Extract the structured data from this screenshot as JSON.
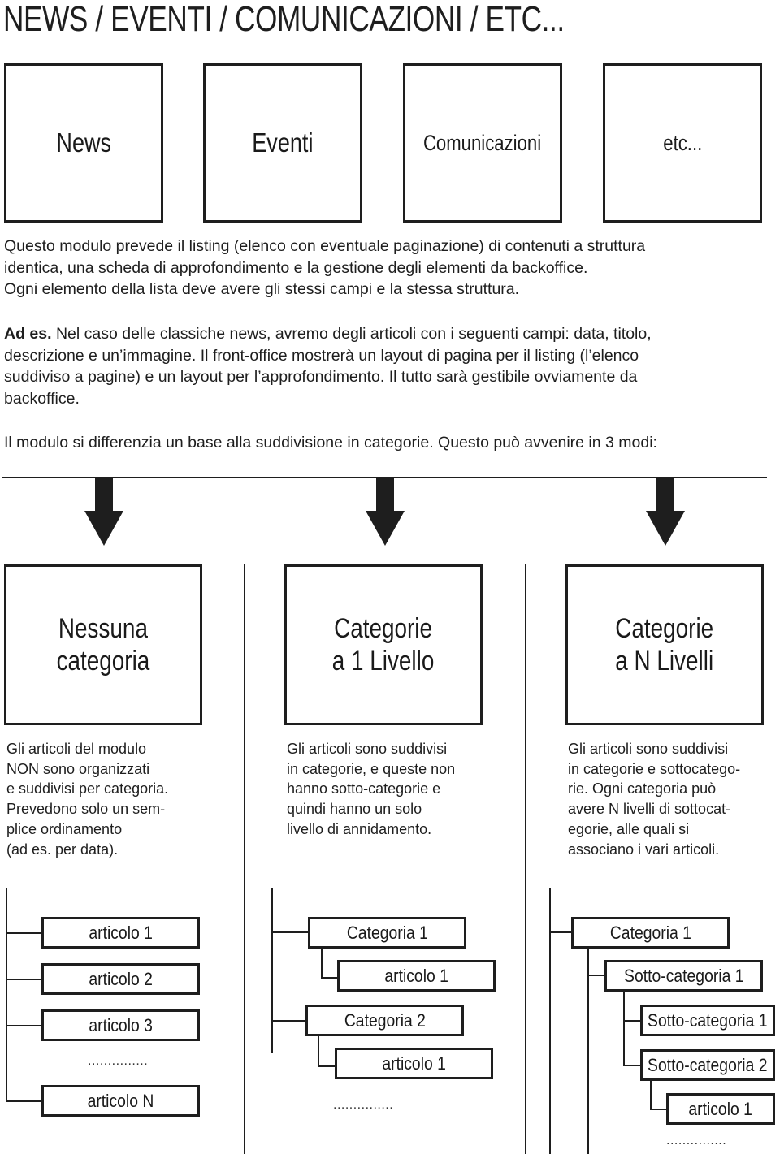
{
  "header": {
    "title": "NEWS / EVENTI / COMUNICAZIONI / ETC..."
  },
  "modules": [
    {
      "label": "News"
    },
    {
      "label": "Eventi"
    },
    {
      "label": "Comunicazioni"
    },
    {
      "label": "etc..."
    }
  ],
  "intro": {
    "p1": [
      "Questo modulo prevede il listing (elenco con eventuale paginazione) di contenuti a struttura",
      "identica, una scheda di approfondimento e la gestione degli elementi da backoffice.",
      "Ogni elemento della lista deve avere gli stessi campi e la stessa struttura."
    ],
    "p2_bold": "Ad es.",
    "p2": [
      " Nel caso delle classiche news, avremo degli articoli con i seguenti campi: data, titolo,",
      "descrizione e un’immagine. Il front-office mostrerà un layout di pagina per il listing (l’elenco",
      "suddiviso a pagine) e un layout per l’approfondimento. Il tutto sarà gestibile ovviamente da",
      "backoffice."
    ],
    "p3": "Il modulo si differenzia un base alla suddivisione in categorie. Questo può avvenire in 3 modi:"
  },
  "modes": [
    {
      "title_line1": "Nessuna",
      "title_line2": "categoria",
      "description": "Gli articoli del modulo\nNON sono organizzati\ne suddivisi per categoria.\nPrevedono solo un sem-\nplice ordinamento\n(ad es. per data).",
      "tree": [
        "articolo 1",
        "articolo 2",
        "articolo 3",
        "...............",
        "articolo N"
      ]
    },
    {
      "title_line1": "Categorie",
      "title_line2": "a 1 Livello",
      "description": "Gli articoli sono suddivisi\nin categorie, e queste non\nhanno sotto-categorie e\nquindi hanno un solo\nlivello di annidamento.",
      "tree": [
        "Categoria 1",
        "articolo 1",
        "Categoria 2",
        "articolo 1",
        "..............."
      ]
    },
    {
      "title_line1": "Categorie",
      "title_line2": "a N Livelli",
      "description": "Gli articoli sono suddivisi\nin categorie e sottocatego-\nrie. Ogni categoria può\navere N livelli di sottocat-\negorie, alle quali si\nassociano i vari articoli.",
      "tree": [
        "Categoria 1",
        "Sotto-categoria 1",
        "Sotto-categoria 1",
        "Sotto-categoria 2",
        "articolo 1",
        "..............."
      ]
    }
  ]
}
